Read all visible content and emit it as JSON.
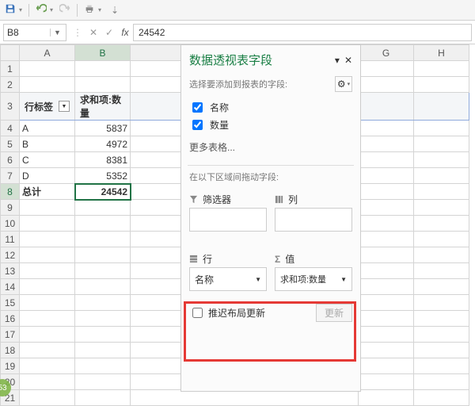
{
  "namebox": "B8",
  "formula": "24542",
  "columns": [
    "A",
    "B",
    "G",
    "H"
  ],
  "pivot": {
    "row_label_hdr": "行标签",
    "value_hdr": "求和项:数量",
    "rows": [
      {
        "label": "A",
        "value": "5837"
      },
      {
        "label": "B",
        "value": "4972"
      },
      {
        "label": "C",
        "value": "8381"
      },
      {
        "label": "D",
        "value": "5352"
      }
    ],
    "total_label": "总计",
    "total_value": "24542"
  },
  "pane": {
    "title": "数据透视表字段",
    "subtitle": "选择要添加到报表的字段:",
    "fields": [
      "名称",
      "数量"
    ],
    "more": "更多表格...",
    "drag_hint": "在以下区域间拖动字段:",
    "areas": {
      "filter": "筛选器",
      "column": "列",
      "row": "行",
      "value": "值"
    },
    "row_item": "名称",
    "value_item": "求和项:数量",
    "defer": "推迟布局更新",
    "update": "更新"
  },
  "badge": "53",
  "chart_data": {
    "type": "table",
    "title": "数据透视表",
    "columns": [
      "行标签",
      "求和项:数量"
    ],
    "rows": [
      [
        "A",
        5837
      ],
      [
        "B",
        4972
      ],
      [
        "C",
        8381
      ],
      [
        "D",
        5352
      ],
      [
        "总计",
        24542
      ]
    ]
  }
}
